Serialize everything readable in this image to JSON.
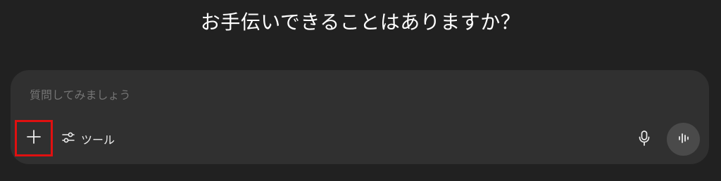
{
  "header": {
    "title": "お手伝いできることはありますか？"
  },
  "composer": {
    "placeholder": "質問してみましょう",
    "tools_label": "ツール",
    "icons": {
      "add": "plus-icon",
      "tools": "sliders-icon",
      "mic": "microphone-icon",
      "voice": "voice-waveform-icon"
    },
    "highlight_color": "#e01010"
  }
}
